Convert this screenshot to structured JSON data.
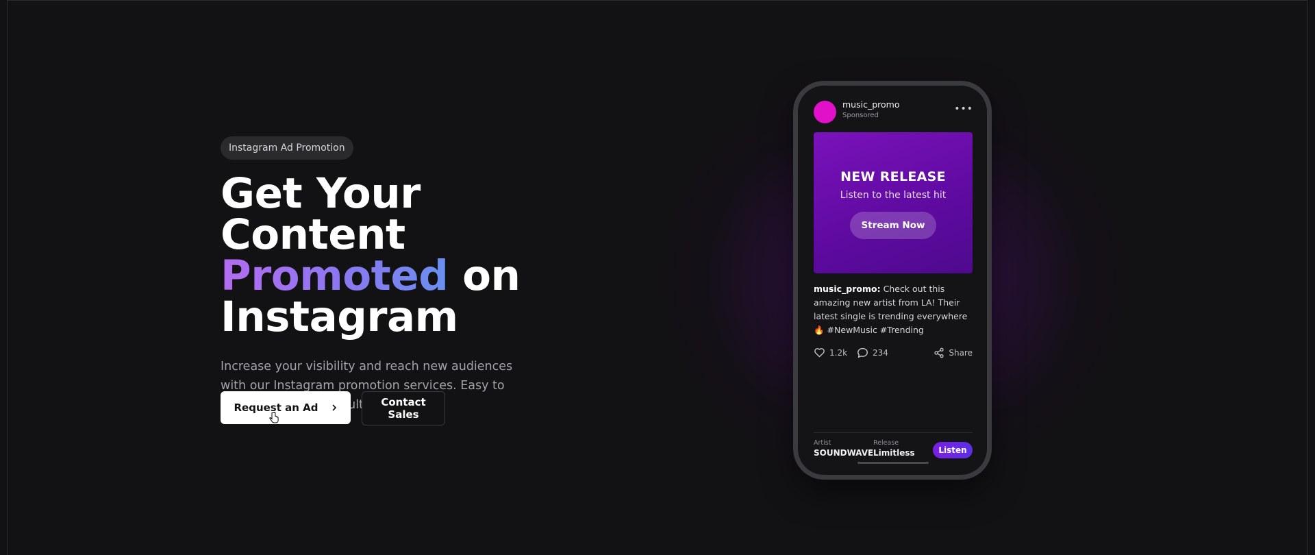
{
  "hero": {
    "badge": "Instagram Ad Promotion",
    "headline_line1": "Get Your Content",
    "headline_accent": "Promoted",
    "headline_on": " on",
    "headline_line3": "Instagram",
    "subtext": "Increase your visibility and reach new audiences with our Instagram promotion services. Easy to request, powerful results.",
    "primary_button": "Request an Ad",
    "secondary_button": "Contact Sales"
  },
  "phone": {
    "username": "music_promo",
    "sponsored": "Sponsored",
    "more_icon": "more-horizontal-icon",
    "creative": {
      "title": "NEW RELEASE",
      "subtitle": "Listen to the latest hit",
      "button": "Stream Now"
    },
    "caption_user": "music_promo:",
    "caption_text": " Check out this amazing new artist from LA! Their latest single is trending everywhere 🔥 #NewMusic #Trending",
    "likes": "1.2k",
    "comments": "234",
    "share": "Share",
    "artist_label": "Artist",
    "artist_value": "SOUNDWAVE",
    "release_label": "Release",
    "release_value": "Limitless",
    "listen_button": "Listen"
  },
  "colors": {
    "background": "#121113",
    "avatar": "#e011c8",
    "creative": "#6a0eb0",
    "accent_gradient_start": "#b46cf0",
    "accent_gradient_end": "#6a8ff0"
  }
}
